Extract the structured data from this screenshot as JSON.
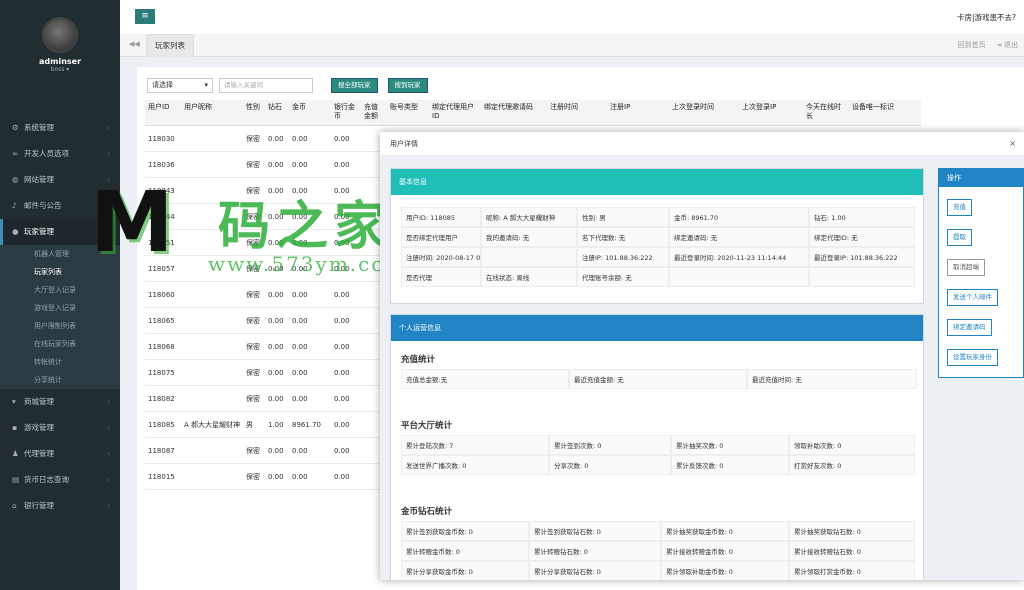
{
  "sidebar": {
    "username": "adminser",
    "role": "boss ▾",
    "items": [
      {
        "label": "系统管理",
        "icon": "gear-icon"
      },
      {
        "label": "开发人员选项",
        "icon": "link-icon"
      },
      {
        "label": "网站管理",
        "icon": "globe-icon"
      },
      {
        "label": "邮件与公告",
        "icon": "bell-icon"
      },
      {
        "label": "玩家管理",
        "icon": "user-icon"
      }
    ],
    "sub_items": [
      "机器人管理",
      "玩家列表",
      "大厅登入记录",
      "游戏登入记录",
      "用户限制列表",
      "在线玩家列表",
      "转帐统计",
      "分享统计"
    ],
    "items_after": [
      {
        "label": "商城管理",
        "icon": "cart-icon"
      },
      {
        "label": "游戏管理",
        "icon": "gamepad-icon"
      },
      {
        "label": "代理管理",
        "icon": "agent-icon"
      },
      {
        "label": "货币日志查询",
        "icon": "log-icon"
      },
      {
        "label": "银行管理",
        "icon": "bank-icon"
      }
    ]
  },
  "topbar": {
    "menu_glyph": "≡",
    "right_text": "卡房|游戏患不去?"
  },
  "tabs": {
    "prev_glyph": "◀◀",
    "active": "玩家列表",
    "refresh": "回到首页",
    "logout": "⇥ 退出"
  },
  "filter": {
    "select_value": "请选择",
    "keyword_placeholder": "请输入关键词",
    "btn_all": "搜全部玩家",
    "btn_search": "搜到玩家"
  },
  "table": {
    "headers": [
      "用户ID",
      "用户昵称",
      "性别",
      "钻石",
      "金币",
      "银行金币",
      "充值金额",
      "账号类型",
      "绑定代理用户ID",
      "绑定代理邀请码",
      "注册时间",
      "注册IP",
      "上次登录时间",
      "上次登录IP",
      "今天在线时长",
      "设备唯一标识"
    ],
    "rows": [
      {
        "id": "118030",
        "nick": "",
        "sex": "保密",
        "dia": "0.00",
        "gold": "0.00",
        "bank": "0.00"
      },
      {
        "id": "118036",
        "nick": "",
        "sex": "保密",
        "dia": "0.00",
        "gold": "0.00",
        "bank": "0.00"
      },
      {
        "id": "118043",
        "nick": "",
        "sex": "保密",
        "dia": "0.00",
        "gold": "0.00",
        "bank": "0.00"
      },
      {
        "id": "118044",
        "nick": "",
        "sex": "保密",
        "dia": "0.00",
        "gold": "0.00",
        "bank": "0.00"
      },
      {
        "id": "118051",
        "nick": "",
        "sex": "保密",
        "dia": "0.00",
        "gold": "0.00",
        "bank": "0.00"
      },
      {
        "id": "118057",
        "nick": "",
        "sex": "保密",
        "dia": "0.00",
        "gold": "0.00",
        "bank": "0.00"
      },
      {
        "id": "118060",
        "nick": "",
        "sex": "保密",
        "dia": "0.00",
        "gold": "0.00",
        "bank": "0.00"
      },
      {
        "id": "118065",
        "nick": "",
        "sex": "保密",
        "dia": "0.00",
        "gold": "0.00",
        "bank": "0.00"
      },
      {
        "id": "118068",
        "nick": "",
        "sex": "保密",
        "dia": "0.00",
        "gold": "0.00",
        "bank": "0.00"
      },
      {
        "id": "118075",
        "nick": "",
        "sex": "保密",
        "dia": "0.00",
        "gold": "0.00",
        "bank": "0.00"
      },
      {
        "id": "118082",
        "nick": "",
        "sex": "保密",
        "dia": "0.00",
        "gold": "0.00",
        "bank": "0.00"
      },
      {
        "id": "118085",
        "nick": "A 郝大大星耀财神",
        "sex": "男",
        "dia": "1.00",
        "gold": "8961.70",
        "bank": "0.00"
      },
      {
        "id": "118087",
        "nick": "",
        "sex": "保密",
        "dia": "0.00",
        "gold": "0.00",
        "bank": "0.00"
      },
      {
        "id": "118015",
        "nick": "",
        "sex": "保密",
        "dia": "0.00",
        "gold": "0.00",
        "bank": "0.00"
      }
    ]
  },
  "modal": {
    "title": "用户详情",
    "close": "⨯",
    "basic": {
      "header": "基本信息",
      "rows": [
        [
          "用户ID: 118085",
          "昵称: A 郝大大星耀财神",
          "性别: 男",
          "金币: 8961.70",
          "钻石: 1.00"
        ],
        [
          "是否绑定代理用户",
          "我的邀请码: 无",
          "名下代理数: 无",
          "绑定邀请码: 无",
          "绑定代理ID: 无"
        ],
        [
          "注册时间: 2020-08-17 00:56:23",
          "",
          "注册IP: 101.88.36.222",
          "最近登录时间: 2020-11-23 11:14:44",
          "最近登录IP: 101.88.36.222"
        ],
        [
          "是否代理",
          "在线状态: 离线",
          "代理账号余额: 无",
          "",
          ""
        ]
      ]
    },
    "personal": {
      "header": "个人运营信息",
      "recharge_title": "充值统计",
      "recharge": [
        "充值总金额:无",
        "最近充值金额: 无",
        "最近充值时间: 无"
      ],
      "hall_title": "平台大厅统计",
      "hall": [
        [
          "累计登陆次数: 7",
          "累计签到次数: 0",
          "累计抽奖次数: 0",
          "领取补助次数: 0"
        ],
        [
          "发送世界广播次数: 0",
          "分享次数: 0",
          "累计反馈次数: 0",
          "打赏好友次数: 0"
        ]
      ],
      "coin_title": "金币钻石统计",
      "coin": [
        [
          "累计签到获取金币数: 0",
          "累计签到获取钻石数: 0",
          "累计抽奖获取金币数: 0",
          "累计抽奖获取钻石数: 0"
        ],
        [
          "累计转赠金币数: 0",
          "累计转赠钻石数: 0",
          "累计接收转赠金币数: 0",
          "累计接收转赠钻石数: 0"
        ],
        [
          "累计分享获取金币数: 0",
          "累计分享获取钻石数: 0",
          "累计领取补助金币数: 0",
          "累计领取打赏金币数: 0"
        ]
      ]
    },
    "ops": {
      "header": "操作",
      "buttons": [
        "充值",
        "提取",
        "取消超端",
        "发送个人邮件",
        "绑定邀请码",
        "设置玩家身份"
      ]
    }
  },
  "watermark": {
    "m": "M",
    "cn": "码之家",
    "url": "www.573ym.com"
  }
}
